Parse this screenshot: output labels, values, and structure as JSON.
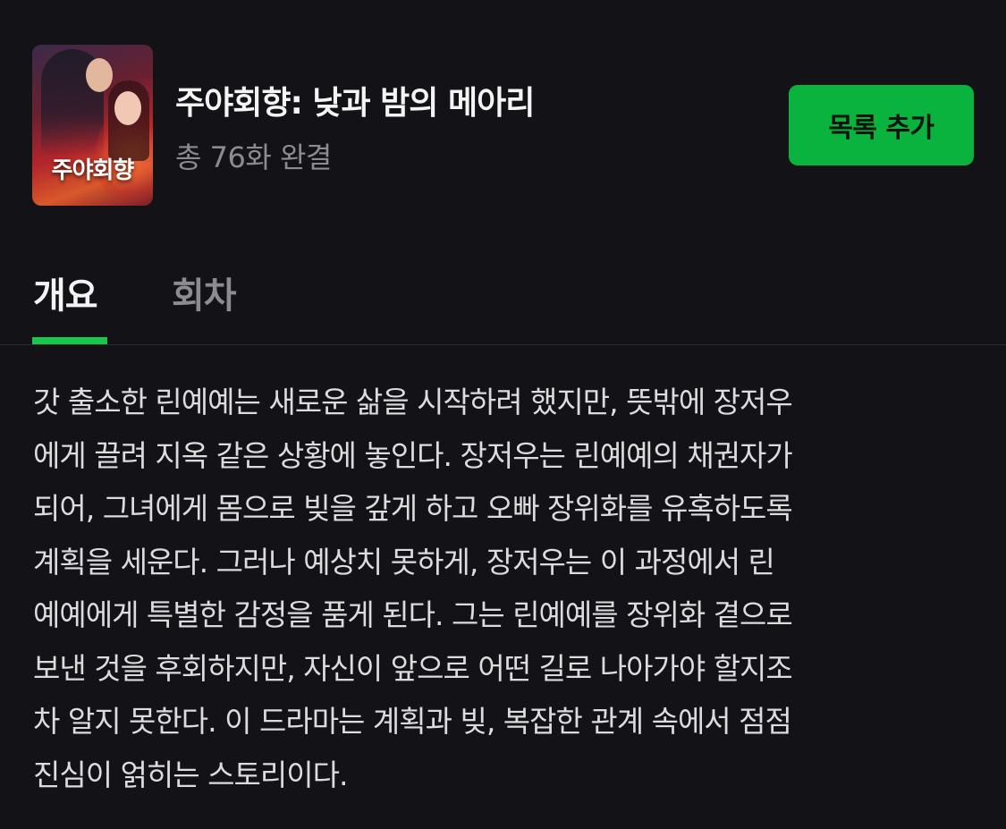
{
  "header": {
    "poster_title": "주야회향",
    "title": "주야회향: 낮과 밤의 메아리",
    "subtitle": "총 76화 완결",
    "add_button_label": "목록 추가"
  },
  "tabs": [
    {
      "label": "개요",
      "active": true
    },
    {
      "label": "회차",
      "active": false
    }
  ],
  "synopsis": {
    "lines": [
      "갓 출소한 린예예는 새로운 삶을 시작하려 했지만, 뜻밖에 장저우",
      "에게 끌려 지옥 같은 상황에 놓인다. 장저우는 린예예의 채권자가",
      "되어, 그녀에게 몸으로 빚을 갚게 하고 오빠 장위화를 유혹하도록",
      "계획을 세운다. 그러나 예상치 못하게, 장저우는 이 과정에서 린",
      "예예에게 특별한 감정을 품게 된다. 그는 린예예를 장위화 곁으로",
      "보낸 것을 후회하지만, 자신이 앞으로 어떤 길로 나아가야 할지조",
      "차 알지 못한다. 이 드라마는 계획과 빚, 복잡한 관계 속에서 점점",
      "진심이 얽히는 스토리이다."
    ]
  },
  "colors": {
    "background": "#121217",
    "accent": "#0ab23e",
    "tab_indicator": "#17c94a",
    "muted_text": "#8b8b92"
  }
}
